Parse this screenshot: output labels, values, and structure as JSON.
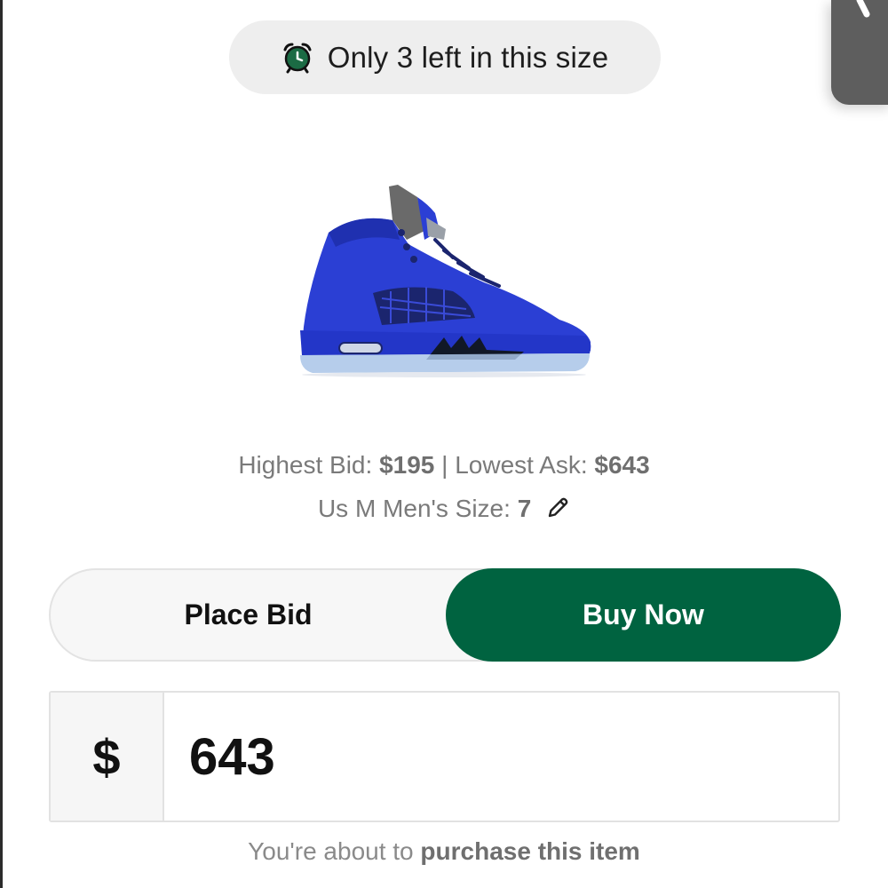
{
  "stock_notice": {
    "text": "Only 3 left in this size",
    "icon": "alarm-clock-icon",
    "icon_color": "#1b6b44"
  },
  "product": {
    "image": "blue-suede-high-top-sneaker",
    "color": "#2b3fd4"
  },
  "market": {
    "highest_bid_label": "Highest Bid:",
    "highest_bid_value": "$195",
    "separator": "|",
    "lowest_ask_label": "Lowest Ask:",
    "lowest_ask_value": "$643"
  },
  "size": {
    "label": "Us M Men's Size:",
    "value": "7",
    "edit_icon": "pencil-icon"
  },
  "mode_toggle": {
    "options": [
      "Place Bid",
      "Buy Now"
    ],
    "selected": "Buy Now",
    "accent_color": "#006340"
  },
  "price_input": {
    "currency_symbol": "$",
    "value": "643"
  },
  "footer": {
    "prefix": "You're about to",
    "action": "purchase this item"
  }
}
